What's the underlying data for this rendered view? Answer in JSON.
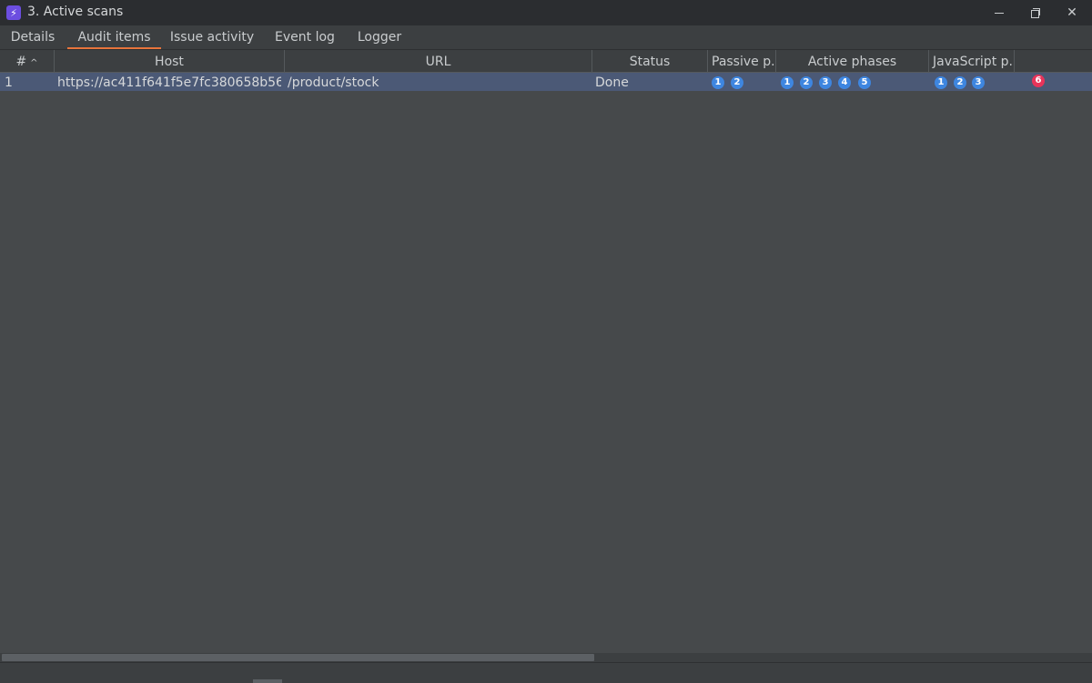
{
  "window": {
    "title": "3. Active scans",
    "app_icon": "lightning-bolt-icon",
    "icon_color": "#6c4ee0"
  },
  "tabs": [
    {
      "label": "Details",
      "active": false
    },
    {
      "label": "Audit items",
      "active": true
    },
    {
      "label": "Issue activity",
      "active": false
    },
    {
      "label": "Event log",
      "active": false
    },
    {
      "label": "Logger",
      "active": false
    }
  ],
  "table": {
    "columns": [
      {
        "label": "#",
        "sort": "ascending"
      },
      {
        "label": "Host"
      },
      {
        "label": "URL"
      },
      {
        "label": "Status"
      },
      {
        "label": "Passive p..."
      },
      {
        "label": "Active phases"
      },
      {
        "label": "JavaScript p..."
      }
    ],
    "rows": [
      {
        "index": "1",
        "host": "https://ac411f641f5e7fc380658b56...",
        "url": "/product/stock",
        "status": "Done",
        "passive_phases": [
          "1",
          "2"
        ],
        "active_phases": [
          "1",
          "2",
          "3",
          "4",
          "5"
        ],
        "javascript_phases": [
          "1",
          "2",
          "3"
        ],
        "extra_badge": "6"
      }
    ]
  },
  "colors": {
    "accent_tab": "#e8743b",
    "phase_badge": "#3e86e0",
    "alert_badge": "#e8345a",
    "selected_row": "#4b5976"
  }
}
